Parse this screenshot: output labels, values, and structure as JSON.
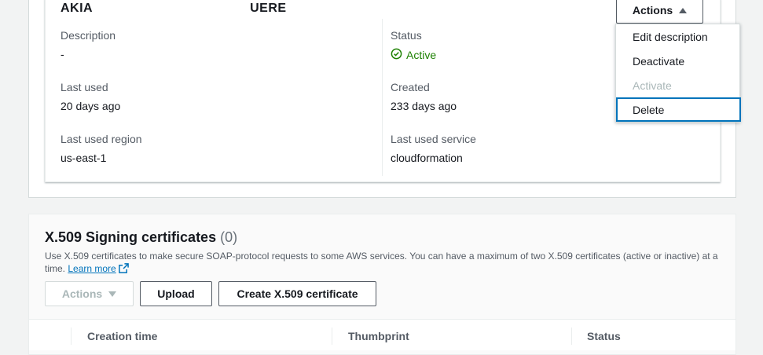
{
  "key": {
    "id_visible": "AKIA",
    "id_tail": "UERE",
    "actions_label": "Actions",
    "fields": {
      "description_label": "Description",
      "description_value": "-",
      "status_label": "Status",
      "status_value": "Active",
      "last_used_label": "Last used",
      "last_used_value": "20 days ago",
      "created_label": "Created",
      "created_value": "233 days ago",
      "last_used_region_label": "Last used region",
      "last_used_region_value": "us-east-1",
      "last_used_service_label": "Last used service",
      "last_used_service_value": "cloudformation"
    },
    "menu": [
      {
        "label": "Edit description",
        "disabled": false
      },
      {
        "label": "Deactivate",
        "disabled": false
      },
      {
        "label": "Activate",
        "disabled": true
      },
      {
        "label": "Delete",
        "disabled": false,
        "focused": true
      }
    ]
  },
  "certs": {
    "title": "X.509 Signing certificates",
    "count": "(0)",
    "description": "Use X.509 certificates to make secure SOAP-protocol requests to some AWS services. You can have a maximum of two X.509 certificates (active or inactive) at a time.",
    "learn_more": "Learn more",
    "actions_label": "Actions",
    "upload_label": "Upload",
    "create_label": "Create X.509 certificate",
    "columns": [
      "Creation time",
      "Thumbprint",
      "Status"
    ]
  },
  "colors": {
    "active_green": "#1d8102",
    "link_blue": "#0073bb",
    "focus_blue": "#0073bb"
  }
}
